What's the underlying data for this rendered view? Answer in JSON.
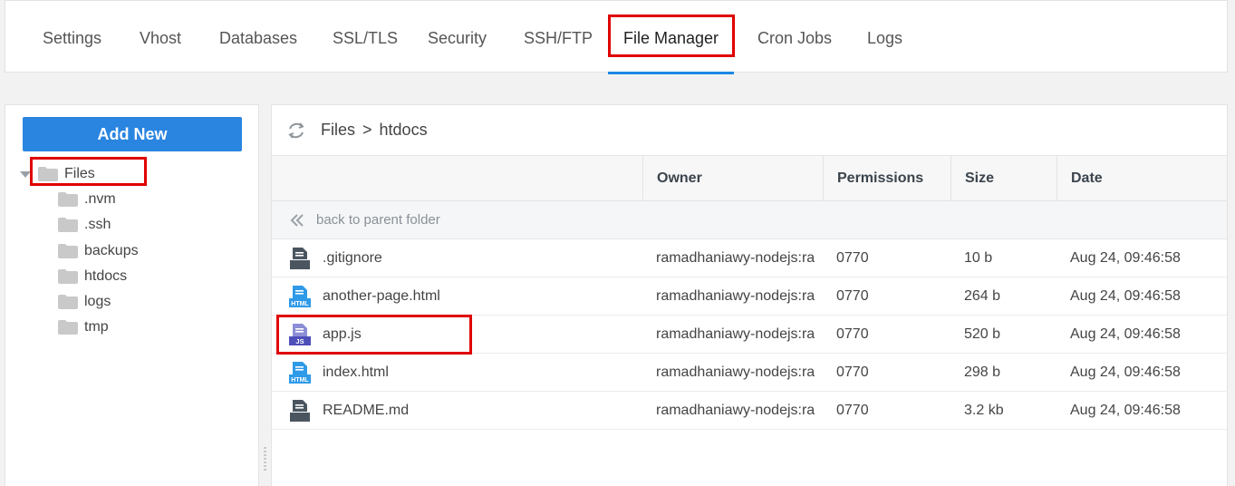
{
  "nav": {
    "tabs": [
      {
        "label": "Settings"
      },
      {
        "label": "Vhost"
      },
      {
        "label": "Databases"
      },
      {
        "label": "SSL/TLS"
      },
      {
        "label": "Security"
      },
      {
        "label": "SSH/FTP"
      },
      {
        "label": "File Manager",
        "active": true
      },
      {
        "label": "Cron Jobs"
      },
      {
        "label": "Logs"
      }
    ]
  },
  "sidebar": {
    "add_new_label": "Add New",
    "root_label": "Files",
    "folders": [
      ".nvm",
      ".ssh",
      "backups",
      "htdocs",
      "logs",
      "tmp"
    ],
    "highlighted_folder": "htdocs"
  },
  "breadcrumb": {
    "root": "Files",
    "separator": ">",
    "current": "htdocs"
  },
  "table": {
    "columns": {
      "name": "",
      "owner": "Owner",
      "permissions": "Permissions",
      "size": "Size",
      "date": "Date"
    },
    "back_label": "back to parent folder",
    "rows": [
      {
        "name": ".gitignore",
        "icon": "text-file-icon",
        "owner": "ramadhaniawy-nodejs:ra",
        "permissions": "0770",
        "size": "10 b",
        "date": "Aug 24, 09:46:58"
      },
      {
        "name": "another-page.html",
        "icon": "html-file-icon",
        "owner": "ramadhaniawy-nodejs:ra",
        "permissions": "0770",
        "size": "264 b",
        "date": "Aug 24, 09:46:58"
      },
      {
        "name": "app.js",
        "icon": "js-file-icon",
        "owner": "ramadhaniawy-nodejs:ra",
        "permissions": "0770",
        "size": "520 b",
        "date": "Aug 24, 09:46:58"
      },
      {
        "name": "index.html",
        "icon": "html-file-icon",
        "owner": "ramadhaniawy-nodejs:ra",
        "permissions": "0770",
        "size": "298 b",
        "date": "Aug 24, 09:46:58"
      },
      {
        "name": "README.md",
        "icon": "text-file-icon",
        "owner": "ramadhaniawy-nodejs:ra",
        "permissions": "0770",
        "size": "3.2 kb",
        "date": "Aug 24, 09:46:58"
      }
    ]
  },
  "colors": {
    "accent": "#2a85e0",
    "highlight": "#e00000",
    "folder": "#c9c9c9",
    "html_icon": "#2f9ae8",
    "js_icon": "#4e4fb8",
    "text_icon": "#4a555f"
  }
}
